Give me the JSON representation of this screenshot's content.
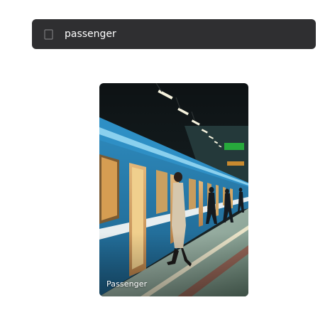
{
  "search": {
    "value": "passenger",
    "icon": "search-icon"
  },
  "results": [
    {
      "caption": "Passenger",
      "image": "subway-train-platform-photo"
    }
  ],
  "colors": {
    "search_bg": "#2f2f31",
    "search_text": "#ffffff",
    "page_bg": "#ffffff",
    "caption_text": "#ffffff"
  }
}
